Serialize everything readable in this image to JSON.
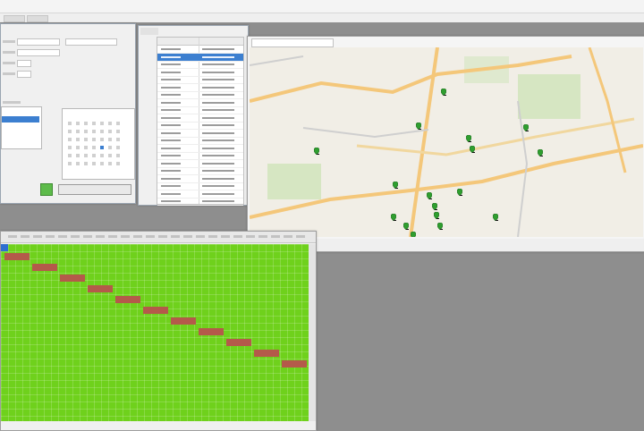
{
  "window": {
    "title": ""
  },
  "calendar": {
    "month": ""
  },
  "actions": {
    "go_label": ""
  },
  "map": {
    "title": "",
    "status_left": "",
    "status_right": ""
  },
  "colors": {
    "grid_green": "#6fd11c",
    "booking_block": "#b45a4a",
    "selection_blue": "#3c7fd0",
    "map_pin": "#2f9e2f"
  }
}
